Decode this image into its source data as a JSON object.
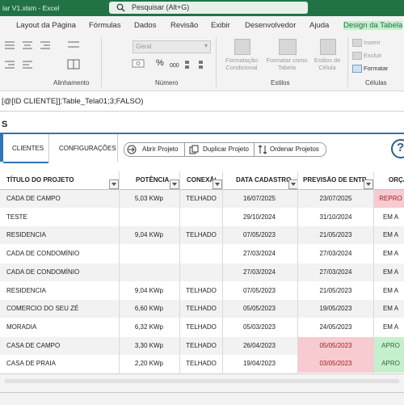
{
  "window": {
    "title": "lar V1.xlsm  -  Excel",
    "search_placeholder": "Pesquisar (Alt+G)"
  },
  "ribbon_tabs": [
    "Layout da Página",
    "Fórmulas",
    "Dados",
    "Revisão",
    "Exibir",
    "Desenvolvedor",
    "Ajuda",
    "Design da Tabela"
  ],
  "ribbon": {
    "number_format": "Geral",
    "group_alignment": "Alinhamento",
    "group_number": "Número",
    "group_styles": "Estilos",
    "group_cells": "Células",
    "cond_format": [
      "Formatação",
      "Condicional"
    ],
    "format_table": [
      "Formatar como",
      "Tabela"
    ],
    "cell_styles": [
      "Estilos de",
      "Célula"
    ],
    "insert": "Inserir",
    "delete": "Excluir",
    "format": "Formatar",
    "percent": "%",
    "thousands": "000"
  },
  "formula_bar": "[@[ID CLIENTE]];Table_Tela01;3;FALSO)",
  "sheet": {
    "title_fragment": "S",
    "nav": {
      "clientes": "CLIENTES",
      "configuracoes": "CONFIGURAÇÕES",
      "abrir": "Abrir Projeto",
      "duplicar": "Duplicar Projeto",
      "ordenar": "Ordenar Projetos",
      "help": "?"
    }
  },
  "table": {
    "headers": {
      "titulo": "TÍTULO DO PROJETO",
      "potencia": "POTÊNCIA",
      "conexao": "CONEXÃO",
      "cadastro": "DATA CADASTRO",
      "previsao": "PREVISÃO DE ENTREGA",
      "orcamento": "ORÇA"
    },
    "rows": [
      {
        "titulo": "CADA DE CAMPO",
        "potencia": "5,03 KWp",
        "conexao": "TELHADO",
        "cadastro": "16/07/2025",
        "previsao": "23/07/2025",
        "status": "REPRO"
      },
      {
        "titulo": "TESTE",
        "potencia": "",
        "conexao": "",
        "cadastro": "29/10/2024",
        "previsao": "31/10/2024",
        "status": "EM A"
      },
      {
        "titulo": "RESIDENCIA",
        "potencia": "9,04 KWp",
        "conexao": "TELHADO",
        "cadastro": "07/05/2023",
        "previsao": "21/05/2023",
        "status": "EM A"
      },
      {
        "titulo": "CADA DE CONDOMÍNIO",
        "potencia": "",
        "conexao": "",
        "cadastro": "27/03/2024",
        "previsao": "27/03/2024",
        "status": "EM A"
      },
      {
        "titulo": "CADA DE CONDOMÍNIO",
        "potencia": "",
        "conexao": "",
        "cadastro": "27/03/2024",
        "previsao": "27/03/2024",
        "status": "EM A"
      },
      {
        "titulo": "RESIDENCIA",
        "potencia": "9,04 KWp",
        "conexao": "TELHADO",
        "cadastro": "07/05/2023",
        "previsao": "21/05/2023",
        "status": "EM A"
      },
      {
        "titulo": "COMERCIO DO SEU ZÉ",
        "potencia": "6,60 KWp",
        "conexao": "TELHADO",
        "cadastro": "05/05/2023",
        "previsao": "19/05/2023",
        "status": "EM A"
      },
      {
        "titulo": "MORADIA",
        "potencia": "6,32 KWp",
        "conexao": "TELHADO",
        "cadastro": "05/03/2023",
        "previsao": "24/05/2023",
        "status": "EM A"
      },
      {
        "titulo": "CASA DE CAMPO",
        "potencia": "3,30 KWp",
        "conexao": "TELHADO",
        "cadastro": "26/04/2023",
        "previsao": "05/05/2023",
        "status": "APRO"
      },
      {
        "titulo": "CASA DE PRAIA",
        "potencia": "2,20 KWp",
        "conexao": "TELHADO",
        "cadastro": "19/04/2023",
        "previsao": "03/05/2023",
        "status": "APRO"
      }
    ]
  },
  "colors": {
    "excel_green": "#217346",
    "accent_blue": "#2e75b6",
    "status_reprovado_bg": "#f8cbd0",
    "status_aprovado_bg": "#c6efce"
  }
}
